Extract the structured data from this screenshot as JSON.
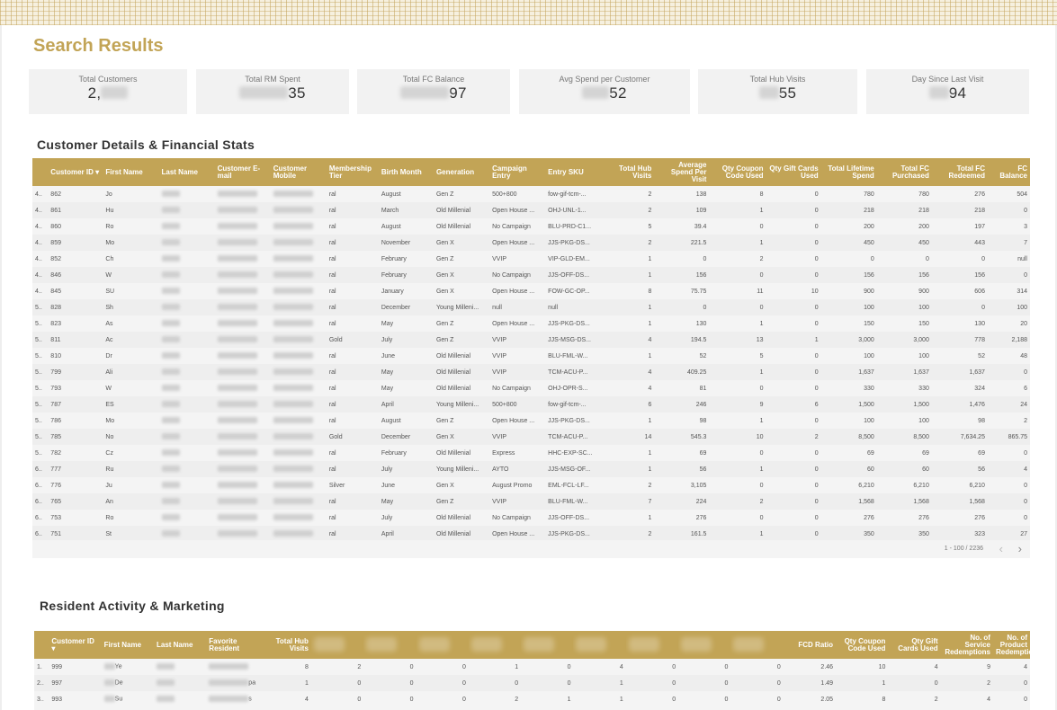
{
  "page": {
    "title": "Search Results"
  },
  "kpis": [
    {
      "label": "Total Customers",
      "prefix": "2,",
      "suffix": ""
    },
    {
      "label": "Total RM Spent",
      "prefix": "",
      "suffix": "35"
    },
    {
      "label": "Total FC Balance",
      "prefix": "",
      "suffix": "97"
    },
    {
      "label": "Avg Spend per Customer",
      "prefix": "",
      "suffix": "52"
    },
    {
      "label": "Total Hub Visits",
      "prefix": "",
      "suffix": "55"
    },
    {
      "label": "Day Since Last Visit",
      "prefix": "",
      "suffix": "94"
    }
  ],
  "section1": {
    "title": "Customer Details & Financial Stats",
    "headers": [
      "",
      "Customer ID ▾",
      "First Name",
      "Last Name",
      "Customer E-mail",
      "Customer Mobile",
      "Membership Tier",
      "Birth Month",
      "Generation",
      "Campaign Entry",
      "Entry SKU",
      "Total Hub Visits",
      "Average Spend Per Visit",
      "Qty Coupon Code Used",
      "Qty Gift Cards Used",
      "Total Lifetime Spend",
      "Total FC Purchased",
      "Total FC Redeemed",
      "FC Balance"
    ],
    "rows": [
      [
        "4..",
        "862",
        "Jo",
        "",
        "",
        "",
        "ral",
        "August",
        "Gen Z",
        "500+800",
        "fow-gif-tcm-...",
        "2",
        "138",
        "8",
        "0",
        "780",
        "780",
        "276",
        "504"
      ],
      [
        "4..",
        "861",
        "Hu",
        "",
        "",
        "",
        "ral",
        "March",
        "Old Millenial",
        "Open House ...",
        "OHJ-UNL-1...",
        "2",
        "109",
        "1",
        "0",
        "218",
        "218",
        "218",
        "0"
      ],
      [
        "4..",
        "860",
        "Ro",
        "",
        "",
        "",
        "ral",
        "August",
        "Old Millenial",
        "No Campaign",
        "BLU-PRD-C1...",
        "5",
        "39.4",
        "0",
        "0",
        "200",
        "200",
        "197",
        "3"
      ],
      [
        "4..",
        "859",
        "Mo",
        "",
        "",
        "",
        "ral",
        "November",
        "Gen X",
        "Open House ...",
        "JJS-PKG-DS...",
        "2",
        "221.5",
        "1",
        "0",
        "450",
        "450",
        "443",
        "7"
      ],
      [
        "4..",
        "852",
        "Ch",
        "",
        "",
        "",
        "ral",
        "February",
        "Gen Z",
        "VVIP",
        "VIP-GLD-EM...",
        "1",
        "0",
        "2",
        "0",
        "0",
        "0",
        "0",
        "null"
      ],
      [
        "4..",
        "846",
        "W",
        "",
        "",
        "",
        "ral",
        "February",
        "Gen X",
        "No Campaign",
        "JJS-OFF-DS...",
        "1",
        "156",
        "0",
        "0",
        "156",
        "156",
        "156",
        "0"
      ],
      [
        "4..",
        "845",
        "SU",
        "",
        "",
        "",
        "ral",
        "January",
        "Gen X",
        "Open House ...",
        "FOW-GC-OP...",
        "8",
        "75.75",
        "11",
        "10",
        "900",
        "900",
        "606",
        "314"
      ],
      [
        "5..",
        "828",
        "Sh",
        "",
        "",
        "",
        "ral",
        "December",
        "Young Milleni...",
        "null",
        "null",
        "1",
        "0",
        "0",
        "0",
        "100",
        "100",
        "0",
        "100"
      ],
      [
        "5..",
        "823",
        "As",
        "",
        "",
        "",
        "ral",
        "May",
        "Gen Z",
        "Open House ...",
        "JJS-PKG-DS...",
        "1",
        "130",
        "1",
        "0",
        "150",
        "150",
        "130",
        "20"
      ],
      [
        "5..",
        "811",
        "Ac",
        "",
        "",
        "",
        "Gold",
        "July",
        "Gen Z",
        "VVIP",
        "JJS-MSG-DS...",
        "4",
        "194.5",
        "13",
        "1",
        "3,000",
        "3,000",
        "778",
        "2,188"
      ],
      [
        "5..",
        "810",
        "Dr",
        "",
        "",
        "",
        "ral",
        "June",
        "Old Millenial",
        "VVIP",
        "BLU-FML-W...",
        "1",
        "52",
        "5",
        "0",
        "100",
        "100",
        "52",
        "48"
      ],
      [
        "5..",
        "799",
        "Ali",
        "",
        "",
        "",
        "ral",
        "May",
        "Old Millenial",
        "VVIP",
        "TCM-ACU-P...",
        "4",
        "409.25",
        "1",
        "0",
        "1,637",
        "1,637",
        "1,637",
        "0"
      ],
      [
        "5..",
        "793",
        "W",
        "",
        "",
        "",
        "ral",
        "May",
        "Old Millenial",
        "No Campaign",
        "OHJ-OPR-S...",
        "4",
        "81",
        "0",
        "0",
        "330",
        "330",
        "324",
        "6"
      ],
      [
        "5..",
        "787",
        "ES",
        "",
        "",
        "",
        "ral",
        "April",
        "Young Milleni...",
        "500+800",
        "fow-gif-tcm-...",
        "6",
        "246",
        "9",
        "6",
        "1,500",
        "1,500",
        "1,476",
        "24"
      ],
      [
        "5..",
        "786",
        "Mo",
        "",
        "",
        "",
        "ral",
        "August",
        "Gen Z",
        "Open House ...",
        "JJS-PKG-DS...",
        "1",
        "98",
        "1",
        "0",
        "100",
        "100",
        "98",
        "2"
      ],
      [
        "5..",
        "785",
        "No",
        "",
        "",
        "",
        "Gold",
        "December",
        "Gen X",
        "VVIP",
        "TCM-ACU-P...",
        "14",
        "545.3",
        "10",
        "2",
        "8,500",
        "8,500",
        "7,634.25",
        "865.75"
      ],
      [
        "5..",
        "782",
        "Cz",
        "",
        "",
        "",
        "ral",
        "February",
        "Old Millenial",
        "Express",
        "HHC-EXP-SC...",
        "1",
        "69",
        "0",
        "0",
        "69",
        "69",
        "69",
        "0"
      ],
      [
        "6..",
        "777",
        "Ru",
        "",
        "",
        "",
        "ral",
        "July",
        "Young Milleni...",
        "AYTO",
        "JJS-MSG-OF...",
        "1",
        "56",
        "1",
        "0",
        "60",
        "60",
        "56",
        "4"
      ],
      [
        "6..",
        "776",
        "Ju",
        "",
        "",
        "",
        "Silver",
        "June",
        "Gen X",
        "August Promo",
        "EML-FCL-LF...",
        "2",
        "3,105",
        "0",
        "0",
        "6,210",
        "6,210",
        "6,210",
        "0"
      ],
      [
        "6..",
        "765",
        "An",
        "",
        "",
        "",
        "ral",
        "May",
        "Gen Z",
        "VVIP",
        "BLU-FML-W...",
        "7",
        "224",
        "2",
        "0",
        "1,568",
        "1,568",
        "1,568",
        "0"
      ],
      [
        "6..",
        "753",
        "Ro",
        "",
        "",
        "",
        "ral",
        "July",
        "Old Millenial",
        "No Campaign",
        "JJS-OFF-DS...",
        "1",
        "276",
        "0",
        "0",
        "276",
        "276",
        "276",
        "0"
      ],
      [
        "6..",
        "751",
        "St",
        "",
        "",
        "",
        "ral",
        "April",
        "Old Millenial",
        "Open House ...",
        "JJS-PKG-DS...",
        "2",
        "161.5",
        "1",
        "0",
        "350",
        "350",
        "323",
        "27"
      ]
    ],
    "pager": {
      "count": "1 - 100 / 2236",
      "prev": "‹",
      "next": "›"
    }
  },
  "section2": {
    "title": "Resident Activity & Marketing",
    "headers": [
      "",
      "Customer ID ▾",
      "First Name",
      "Last Name",
      "Favorite Resident",
      "Total Hub Visits",
      "",
      "",
      "",
      "",
      "",
      "",
      "",
      "",
      "",
      "FCD Ratio",
      "Qty Coupon Code Used",
      "Qty Gift Cards Used",
      "No. of Service Redemptions",
      "No. of Product Redemptions"
    ],
    "rows": [
      [
        "1.",
        "999",
        "Ye",
        "",
        "",
        "8",
        "2",
        "0",
        "0",
        "1",
        "0",
        "4",
        "0",
        "0",
        "0",
        "2.46",
        "10",
        "4",
        "9",
        "4"
      ],
      [
        "2..",
        "997",
        "De",
        "",
        "pa",
        "1",
        "0",
        "0",
        "0",
        "0",
        "0",
        "1",
        "0",
        "0",
        "0",
        "1.49",
        "1",
        "0",
        "2",
        "0"
      ],
      [
        "3..",
        "993",
        "Su",
        "",
        "s",
        "4",
        "0",
        "0",
        "0",
        "2",
        "1",
        "1",
        "0",
        "0",
        "0",
        "2.05",
        "8",
        "2",
        "4",
        "0"
      ]
    ]
  },
  "colors": {
    "accent": "#c2a456",
    "header_text": "#ffffff",
    "card_bg": "#f2f2f2"
  }
}
